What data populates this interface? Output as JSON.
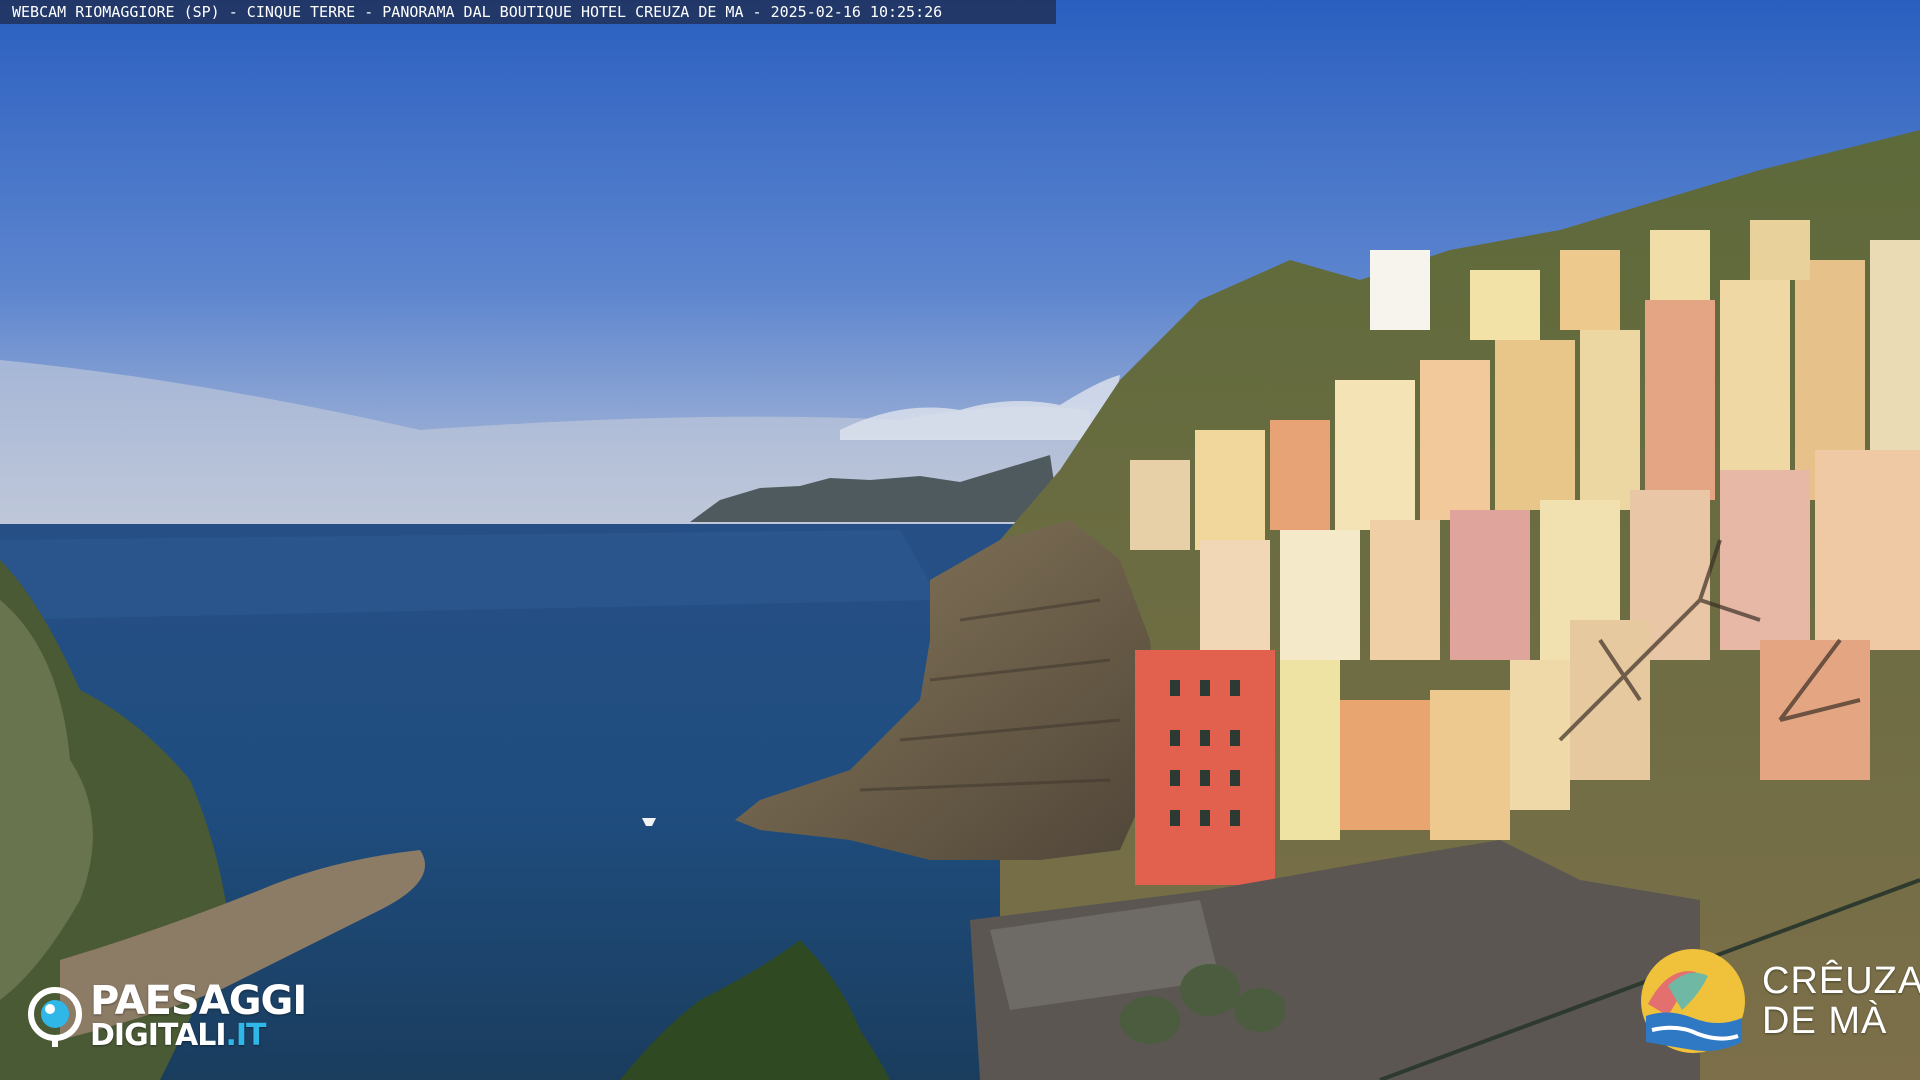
{
  "overlay": {
    "title": "WEBCAM RIOMAGGIORE (SP) - CINQUE TERRE - PANORAMA DAL BOUTIQUE HOTEL CREUZA DE MA - 2025-02-16 10:25:26"
  },
  "logos": {
    "left": {
      "line1": "PAESAGGI",
      "line2_main": "DIGITALI",
      "line2_suffix": ".IT",
      "icon": "camera-eye-icon"
    },
    "right": {
      "line1": "CRÊUZA",
      "line2": "DE MÀ",
      "icon": "wave-sun-icon"
    }
  },
  "colors": {
    "sky_top": "#2a5fc0",
    "sky_horizon": "#b9c3d8",
    "sea": "#1f4d7f",
    "accent_blue": "#2fb7e8"
  }
}
